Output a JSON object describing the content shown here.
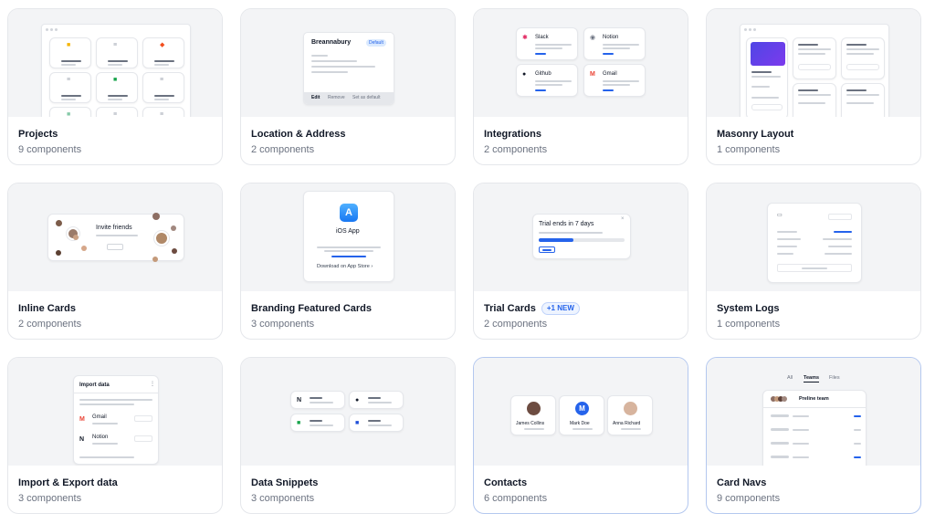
{
  "cards": [
    {
      "title": "Projects",
      "subtitle": "9 components"
    },
    {
      "title": "Location & Address",
      "subtitle": "2 components",
      "preview": {
        "name": "Breannabury",
        "badge": "Default",
        "actions": [
          "Edit",
          "Remove",
          "Set as default"
        ]
      }
    },
    {
      "title": "Integrations",
      "subtitle": "2 components",
      "preview": {
        "apps": [
          "Slack",
          "Notion",
          "Github",
          "Gmail"
        ]
      }
    },
    {
      "title": "Masonry Layout",
      "subtitle": "1 components"
    },
    {
      "title": "Inline Cards",
      "subtitle": "2 components",
      "preview": {
        "heading": "Invite friends"
      }
    },
    {
      "title": "Branding Featured Cards",
      "subtitle": "3 components",
      "preview": {
        "app": "iOS App",
        "link": "Download on App Store ›"
      }
    },
    {
      "title": "Trial Cards",
      "subtitle": "2 components",
      "badge": "+1 NEW",
      "preview": {
        "heading": "Trial ends in 7 days"
      }
    },
    {
      "title": "System Logs",
      "subtitle": "1 components"
    },
    {
      "title": "Import & Export data",
      "subtitle": "3 components",
      "preview": {
        "heading": "Import data",
        "items": [
          "Gmail",
          "Notion"
        ]
      }
    },
    {
      "title": "Data Snippets",
      "subtitle": "3 components"
    },
    {
      "title": "Contacts",
      "subtitle": "6 components",
      "preview": {
        "people": [
          "James Collins",
          "Mark Doe",
          "Anna Richard"
        ]
      }
    },
    {
      "title": "Card Navs",
      "subtitle": "9 components",
      "preview": {
        "tabs": [
          "All",
          "Teams",
          "Files"
        ],
        "team": "Preline team"
      }
    }
  ],
  "colors": {
    "accent": "#2563eb",
    "preview_bg": "#f3f4f6",
    "card_border": "#e5e7eb",
    "highlight_border": "#b4c8ef",
    "masonry_gradient": [
      "#4f46e5",
      "#7c3aed"
    ]
  }
}
